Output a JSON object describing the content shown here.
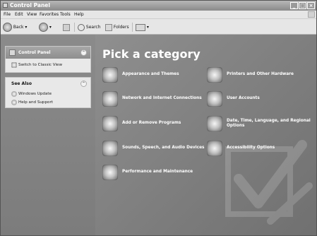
{
  "window": {
    "title": "Control Panel"
  },
  "menu": [
    "File",
    "Edit",
    "View",
    "Favorites",
    "Tools",
    "Help"
  ],
  "toolbar": {
    "back_label": "Back",
    "search_label": "Search",
    "folders_label": "Folders"
  },
  "sidebar": {
    "panel1": {
      "title": "Control Panel",
      "items": [
        {
          "label": "Switch to Classic View"
        }
      ]
    },
    "panel2": {
      "title": "See Also",
      "items": [
        {
          "label": "Windows Update"
        },
        {
          "label": "Help and Support"
        }
      ]
    }
  },
  "main": {
    "title": "Pick a category",
    "categories": [
      {
        "label": "Appearance and Themes"
      },
      {
        "label": "Printers and Other Hardware"
      },
      {
        "label": "Network and Internet Connections"
      },
      {
        "label": "User Accounts"
      },
      {
        "label": "Add or Remove Programs"
      },
      {
        "label": "Date, Time, Language, and Regional Options"
      },
      {
        "label": "Sounds, Speech, and Audio Devices"
      },
      {
        "label": "Accessibility Options"
      },
      {
        "label": "Performance and Maintenance"
      }
    ]
  }
}
